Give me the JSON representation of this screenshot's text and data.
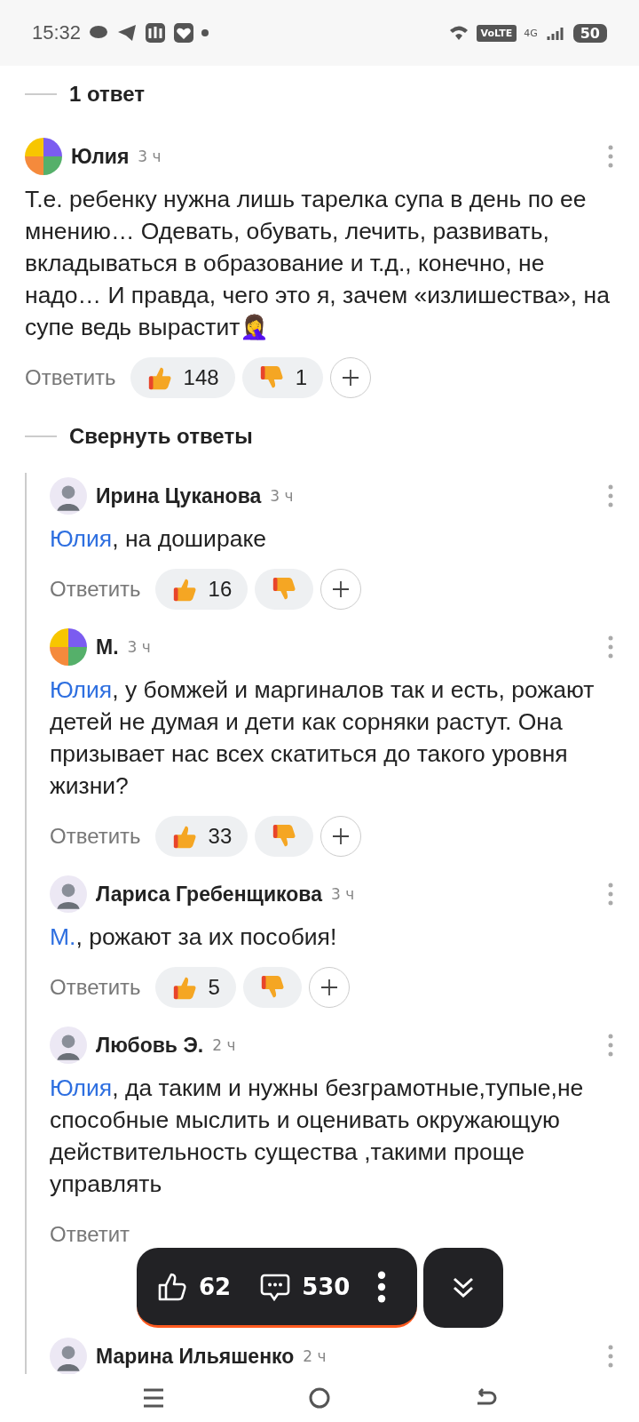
{
  "status_bar": {
    "time": "15:32",
    "volte": "VoLTE",
    "network": "4G",
    "battery": "50"
  },
  "thread_header": {
    "label": "1 ответ"
  },
  "comment": {
    "author": "Юлия",
    "time": "3 ч",
    "avatar": {
      "kind": "pie"
    },
    "text": "Т.е. ребенку нужна лишь тарелка супа в день по ее мнению… Одевать, обувать, лечить, развивать, вкладываться в образование и т.д., конечно, не надо… И правда, чего это я, зачем «излишества», на супе ведь вырастит🤦‍♀️",
    "reply_label": "Ответить",
    "likes": "148",
    "dislikes": "1"
  },
  "collapse_label": "Свернуть ответы",
  "replies": [
    {
      "author": "Ирина Цуканова",
      "time": "3 ч",
      "avatar": {
        "kind": "photo"
      },
      "mention": "Юлия",
      "text": ", на дошираке",
      "reply_label": "Ответить",
      "likes": "16"
    },
    {
      "author": "М.",
      "time": "3 ч",
      "avatar": {
        "kind": "pie"
      },
      "mention": "Юлия",
      "text": ", у бомжей и маргиналов так и есть, рожают детей не думая и дети как сорняки растут. Она призывает нас всех скатиться до такого уровня жизни?",
      "reply_label": "Ответить",
      "likes": "33"
    },
    {
      "author": "Лариса Гребенщикова",
      "time": "3 ч",
      "avatar": {
        "kind": "photo"
      },
      "mention": "М.",
      "text": ", рожают за их пособия!",
      "reply_label": "Ответить",
      "likes": "5"
    },
    {
      "author": "Любовь Э.",
      "time": "2 ч",
      "avatar": {
        "kind": "photo"
      },
      "mention": "Юлия",
      "text": ", да таким и нужны безграмотные,тупые,не способные мыслить и оценивать окружающую действительность существа ,такими проще управлять",
      "reply_label": "Ответит"
    },
    {
      "author": "Марина Ильяшенко",
      "time": "2 ч",
      "avatar": {
        "kind": "photo"
      }
    }
  ],
  "floating_bar": {
    "likes": "62",
    "comments": "530"
  }
}
